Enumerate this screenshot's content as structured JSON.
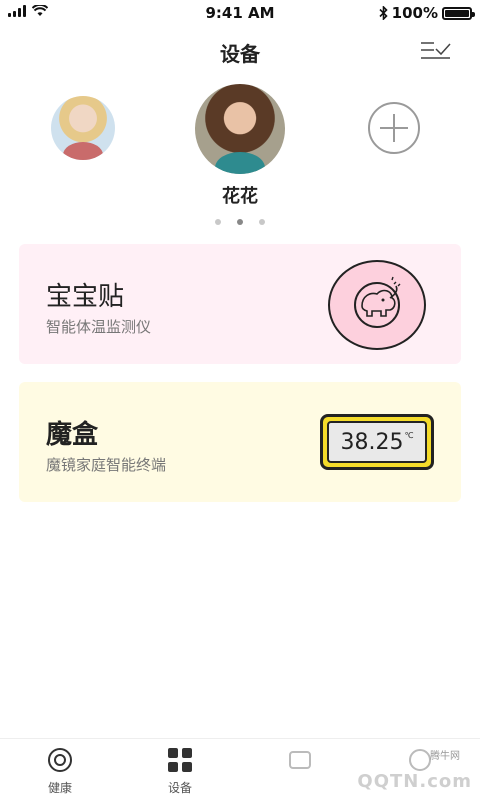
{
  "status_bar": {
    "time": "9:41 AM",
    "battery": "100%",
    "battery_level": 1.0
  },
  "nav": {
    "title": "设备",
    "action_icon": "list-check-icon"
  },
  "profiles": {
    "selected_name": "花花",
    "page_count": 3,
    "active_page": 2
  },
  "cards": [
    {
      "title": "宝宝贴",
      "subtitle": "智能体温监测仪",
      "icon": "baby-elephant-icon"
    },
    {
      "title": "魔盒",
      "subtitle": "魔镜家庭智能终端",
      "display_value": "38.25",
      "display_unit": "℃"
    }
  ],
  "tabbar": {
    "tabs": [
      {
        "label": "健康",
        "icon": "target-icon"
      },
      {
        "label": "设备",
        "icon": "grid-icon"
      },
      {
        "label": "",
        "icon": "tab-icon"
      },
      {
        "label": "",
        "icon": "tab-icon"
      }
    ],
    "watermark_small": "腾牛网",
    "watermark": "QQTN.com"
  }
}
